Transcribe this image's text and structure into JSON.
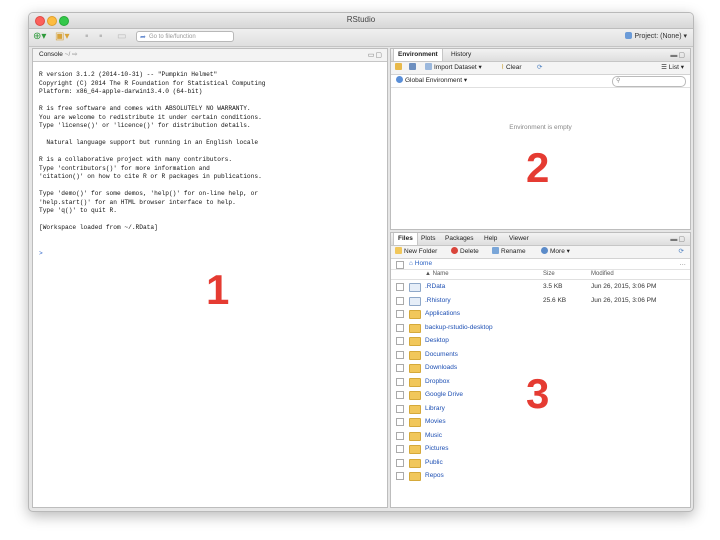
{
  "window": {
    "title": "RStudio"
  },
  "toolbar": {
    "goto_placeholder": "Go to file/function",
    "project_label": "Project: (None)"
  },
  "console": {
    "tab_label": "Console",
    "path": "~/",
    "lines": [
      "R version 3.1.2 (2014-10-31) -- \"Pumpkin Helmet\"",
      "Copyright (C) 2014 The R Foundation for Statistical Computing",
      "Platform: x86_64-apple-darwin13.4.0 (64-bit)",
      "",
      "R is free software and comes with ABSOLUTELY NO WARRANTY.",
      "You are welcome to redistribute it under certain conditions.",
      "Type 'license()' or 'licence()' for distribution details.",
      "",
      "  Natural language support but running in an English locale",
      "",
      "R is a collaborative project with many contributors.",
      "Type 'contributors()' for more information and",
      "'citation()' on how to cite R or R packages in publications.",
      "",
      "Type 'demo()' for some demos, 'help()' for on-line help, or",
      "'help.start()' for an HTML browser interface to help.",
      "Type 'q()' to quit R.",
      "",
      "[Workspace loaded from ~/.RData]",
      "",
      ""
    ],
    "prompt": ">"
  },
  "environment": {
    "tabs": [
      "Environment",
      "History"
    ],
    "import_label": "Import Dataset",
    "clear_label": "Clear",
    "list_label": "List",
    "scope_label": "Global Environment",
    "empty_text": "Environment is empty"
  },
  "files": {
    "tabs": [
      "Files",
      "Plots",
      "Packages",
      "Help",
      "Viewer"
    ],
    "new_folder_label": "New Folder",
    "delete_label": "Delete",
    "rename_label": "Rename",
    "more_label": "More",
    "breadcrumb": "Home",
    "columns": {
      "name": "Name",
      "size": "Size",
      "modified": "Modified"
    },
    "rows": [
      {
        "name": ".RData",
        "size": "3.5 KB",
        "modified": "Jun 26, 2015, 3:06 PM",
        "kind": "file"
      },
      {
        "name": ".Rhistory",
        "size": "25.6 KB",
        "modified": "Jun 26, 2015, 3:06 PM",
        "kind": "file"
      },
      {
        "name": "Applications",
        "size": "",
        "modified": "",
        "kind": "folder"
      },
      {
        "name": "backup-rstudio-desktop",
        "size": "",
        "modified": "",
        "kind": "folder"
      },
      {
        "name": "Desktop",
        "size": "",
        "modified": "",
        "kind": "folder"
      },
      {
        "name": "Documents",
        "size": "",
        "modified": "",
        "kind": "folder"
      },
      {
        "name": "Downloads",
        "size": "",
        "modified": "",
        "kind": "folder"
      },
      {
        "name": "Dropbox",
        "size": "",
        "modified": "",
        "kind": "folder"
      },
      {
        "name": "Google Drive",
        "size": "",
        "modified": "",
        "kind": "folder"
      },
      {
        "name": "Library",
        "size": "",
        "modified": "",
        "kind": "folder"
      },
      {
        "name": "Movies",
        "size": "",
        "modified": "",
        "kind": "folder"
      },
      {
        "name": "Music",
        "size": "",
        "modified": "",
        "kind": "folder"
      },
      {
        "name": "Pictures",
        "size": "",
        "modified": "",
        "kind": "folder"
      },
      {
        "name": "Public",
        "size": "",
        "modified": "",
        "kind": "folder"
      },
      {
        "name": "Repos",
        "size": "",
        "modified": "",
        "kind": "folder"
      }
    ]
  },
  "annotations": {
    "one": "1",
    "two": "2",
    "three": "3"
  },
  "colors": {
    "annotation": "#e53b32",
    "link": "#1d4fb3"
  }
}
